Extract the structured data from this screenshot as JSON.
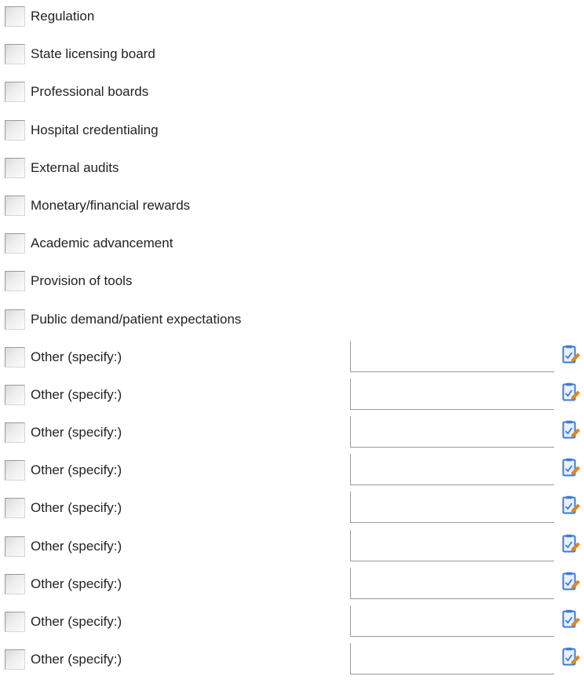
{
  "options": [
    {
      "label": "Regulation",
      "checked": false
    },
    {
      "label": "State licensing board",
      "checked": false
    },
    {
      "label": "Professional boards",
      "checked": false
    },
    {
      "label": "Hospital credentialing",
      "checked": false
    },
    {
      "label": "External audits",
      "checked": false
    },
    {
      "label": "Monetary/financial rewards",
      "checked": false
    },
    {
      "label": "Academic advancement",
      "checked": false
    },
    {
      "label": "Provision of tools",
      "checked": false
    },
    {
      "label": "Public demand/patient expectations",
      "checked": false
    }
  ],
  "other_options": [
    {
      "label": "Other (specify:)",
      "checked": false,
      "value": ""
    },
    {
      "label": "Other (specify:)",
      "checked": false,
      "value": ""
    },
    {
      "label": "Other (specify:)",
      "checked": false,
      "value": ""
    },
    {
      "label": "Other (specify:)",
      "checked": false,
      "value": ""
    },
    {
      "label": "Other (specify:)",
      "checked": false,
      "value": ""
    },
    {
      "label": "Other (specify:)",
      "checked": false,
      "value": ""
    },
    {
      "label": "Other (specify:)",
      "checked": false,
      "value": ""
    },
    {
      "label": "Other (specify:)",
      "checked": false,
      "value": ""
    },
    {
      "label": "Other (specify:)",
      "checked": false,
      "value": ""
    }
  ],
  "icons": {
    "edit": "edit-note-icon"
  },
  "colors": {
    "text": "#222222",
    "checkbox_border": "#9a9a9a",
    "icon_blue": "#3d7ad6",
    "icon_orange": "#e0861c"
  }
}
